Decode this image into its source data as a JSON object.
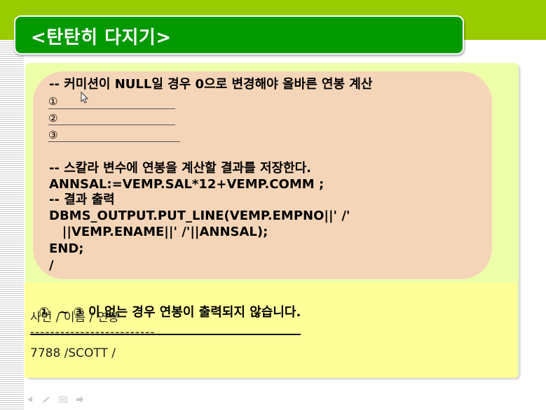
{
  "title": "<탄탄히 다지기>",
  "code": {
    "comment1": "-- 커미션이 NULL일 경우 0으로 변경해야 올바른 연봉 계산",
    "blanks": [
      "①",
      "②",
      "③"
    ],
    "comment2": "-- 스칼라 변수에 연봉을 계산할 결과를 저장한다.",
    "line_annsal": "ANNSAL:=VEMP.SAL*12+VEMP.COMM ;",
    "comment3": "-- 결과 출력",
    "line_put1": "DBMS_OUTPUT.PUT_LINE(VEMP.EMPNO||' /'",
    "line_put2": "   ||VEMP.ENAME||' /'||ANNSAL);",
    "line_end": "END;",
    "line_slash": "/"
  },
  "result": {
    "title": "①  ~ ③ 이 없는 경우 연봉이 출력되지 않습니다.",
    "header": "사번 / 이름 / 연봉",
    "separator": "-------------------------",
    "row": "7788 /SCOTT /"
  },
  "colors": {
    "band": "#99cc00",
    "title_tab": "#009900",
    "panel": "#eeffaa",
    "code_box": "#f5d5b8",
    "result_box": "#ffff99"
  },
  "icons": [
    "prev-icon",
    "pen-icon",
    "menu-icon",
    "next-icon"
  ]
}
